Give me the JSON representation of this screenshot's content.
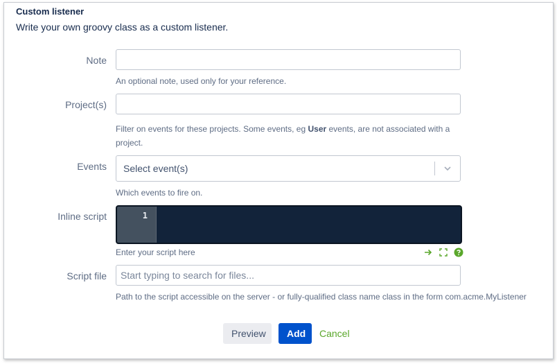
{
  "header": {
    "title": "Custom listener",
    "subtitle": "Write your own groovy class as a custom listener."
  },
  "fields": {
    "note": {
      "label": "Note",
      "value": "",
      "help": "An optional note, used only for your reference."
    },
    "projects": {
      "label": "Project(s)",
      "value": "",
      "help_prefix": "Filter on events for these projects. Some events, eg ",
      "help_bold": "User",
      "help_suffix": " events, are not associated with a project."
    },
    "events": {
      "label": "Events",
      "placeholder": "Select event(s)",
      "help": "Which events to fire on."
    },
    "inline_script": {
      "label": "Inline script",
      "line_number": "1",
      "help": "Enter your script here",
      "tools": [
        "arrow-right-icon",
        "fullscreen-icon",
        "help-circle-icon"
      ]
    },
    "script_file": {
      "label": "Script file",
      "placeholder": "Start typing to search for files...",
      "help": "Path to the script accessible on the server - or fully-qualified class name class in the form com.acme.MyListener"
    }
  },
  "actions": {
    "preview_label": "Preview",
    "add_label": "Add",
    "cancel_label": "Cancel"
  },
  "colors": {
    "primary": "#0052cc",
    "link_green": "#5aa72b",
    "editor_bg": "#12233a"
  }
}
